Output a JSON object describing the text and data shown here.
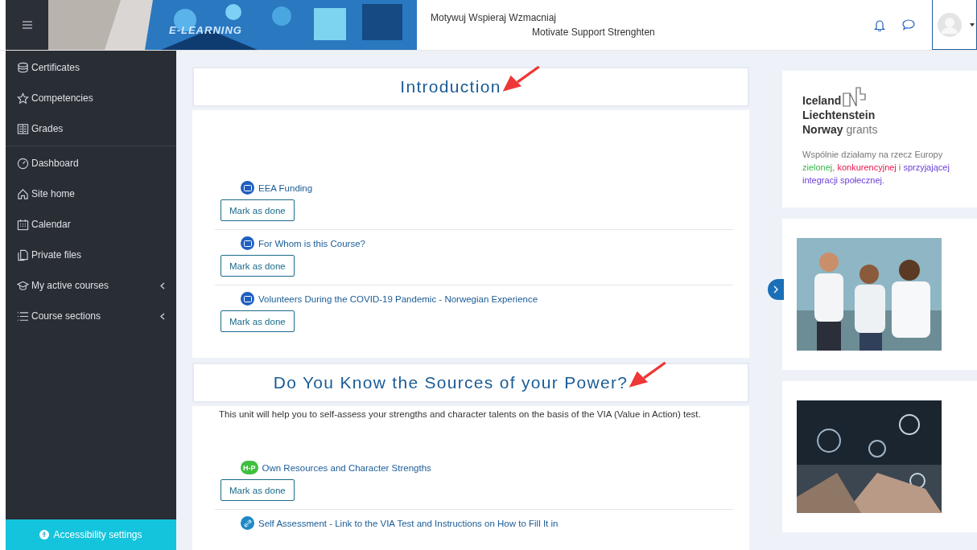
{
  "header": {
    "banner": {
      "kind": "picture",
      "caption": "E-LEARNING"
    },
    "title": "Motywuj Wspieraj Wzmacniaj",
    "subtitle": "Motivate Support Strenghten"
  },
  "sidebar": {
    "groups": [
      [
        {
          "label": "Certificates",
          "kind": "link"
        },
        {
          "label": "Competencies",
          "kind": "link"
        },
        {
          "label": "Grades",
          "kind": "link"
        }
      ],
      [
        {
          "label": "Dashboard",
          "kind": "link"
        },
        {
          "label": "Site home",
          "kind": "link"
        },
        {
          "label": "Calendar",
          "kind": "link"
        },
        {
          "label": "Private files",
          "kind": "link"
        },
        {
          "label": "My active courses",
          "kind": "collapsible",
          "expanded": false
        },
        {
          "label": "Course sections",
          "kind": "collapsible",
          "expanded": false
        }
      ]
    ],
    "footer": "Accessibility settings"
  },
  "sections": [
    {
      "title": "Introduction",
      "activities": [
        {
          "kind": "page",
          "name": "EEA Funding",
          "button": "Mark as done"
        },
        {
          "kind": "page",
          "name": "For Whom is this Course?",
          "button": "Mark as done"
        },
        {
          "kind": "page",
          "name": "Volunteers During the COVID-19 Pandemic - Norwegian Experience",
          "button": "Mark as done"
        }
      ]
    },
    {
      "title": "Do You Know the Sources of your Power?",
      "description": "This unit will help you to self-assess your strengths and character talents on the basis of the VIA (Value in Action) test.",
      "activities": [
        {
          "kind": "h5p",
          "name": "Own Resources and Character Strengths",
          "badge": "H-P",
          "button": "Mark as done"
        },
        {
          "kind": "url",
          "name": "Self Assessment - Link to the VIA Test and Instructions on How to Fill It in"
        }
      ]
    }
  ],
  "right": {
    "logo": {
      "lines": [
        "Iceland",
        "Liechtenstein",
        "Norway"
      ],
      "suffix": "grants"
    },
    "tagline": [
      {
        "text": "Wspólnie działamy na rzecz Europy "
      },
      {
        "text": "zielonej",
        "color": "#3cb44b"
      },
      {
        "text": ", "
      },
      {
        "text": "konkurencyjnej",
        "color": "#e6194b"
      },
      {
        "text": " i "
      },
      {
        "text": "sprzyjającej integracji społecznej",
        "color": "#6a3fd8"
      },
      {
        "text": "."
      }
    ]
  }
}
